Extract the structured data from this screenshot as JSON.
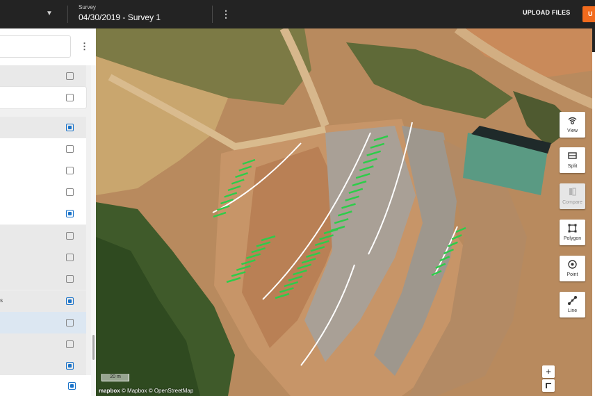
{
  "topbar": {
    "survey_label": "Survey",
    "survey_title": "04/30/2019 - Survey 1",
    "upload_label": "UPLOAD FILES",
    "orange_button_label": "U"
  },
  "panel": {
    "truncated_row_text": "s",
    "rows": [
      {
        "checked": false
      },
      {
        "checked": false
      },
      {
        "checked": true
      },
      {
        "checked": false
      },
      {
        "checked": false
      },
      {
        "checked": false
      },
      {
        "checked": true
      },
      {
        "checked": false
      },
      {
        "checked": false
      },
      {
        "checked": false
      },
      {
        "checked": true
      },
      {
        "checked": false
      },
      {
        "checked": false
      },
      {
        "checked": true
      },
      {
        "checked": true
      }
    ]
  },
  "map": {
    "scale_label": "20 m",
    "attribution": "© Mapbox © OpenStreetMap",
    "logo_text": "mapbox",
    "zoom_in": "+",
    "tools": [
      {
        "label": "View",
        "icon": "view-icon"
      },
      {
        "label": "Split",
        "icon": "split-icon"
      },
      {
        "label": "Compare",
        "icon": "compare-icon"
      },
      {
        "label": "Polygon",
        "icon": "polygon-icon"
      },
      {
        "label": "Point",
        "icon": "point-icon"
      },
      {
        "label": "Line",
        "icon": "line-icon"
      }
    ]
  },
  "colors": {
    "accent": "#f26b1d",
    "checkbox_on": "#1a73c9",
    "annotation": "#2ecc4a"
  }
}
